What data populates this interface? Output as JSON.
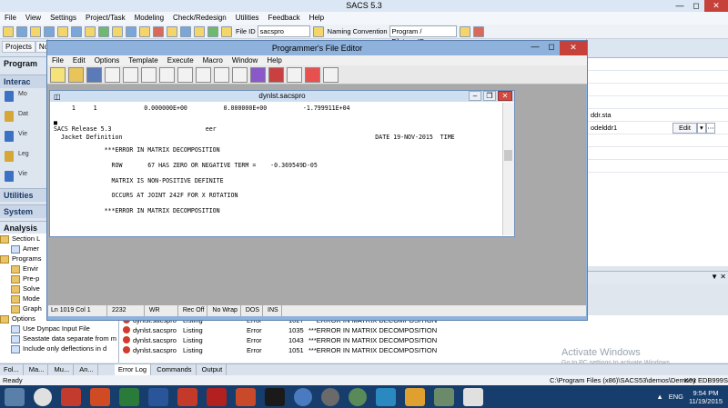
{
  "app": {
    "title": "SACS 5.3"
  },
  "menu": [
    "File",
    "View",
    "Settings",
    "Project/Task",
    "Modeling",
    "Check/Redesign",
    "Utilities",
    "Feedback",
    "Help"
  ],
  "toolbar": {
    "file_id_label": "File ID",
    "file_id_value": "sacspro",
    "naming_label": "Naming Convention",
    "naming_value": "Program / Filetype.ID"
  },
  "left": {
    "tabs": [
      "Projects",
      "No"
    ],
    "program_head": "Program",
    "interactive": "Interac",
    "items": [
      "Mo",
      "Dat",
      "Vie",
      "Leg",
      "Vie"
    ],
    "utilities": "Utilities",
    "system": "System",
    "analysis": "Analysis S"
  },
  "tree": [
    "Section L",
    "Amer",
    "Programs",
    "Envir",
    "Pre-p",
    "Solve",
    "Mode",
    "Graph",
    "Options",
    "Use Dynpac Input File",
    "Seastate data separate from m",
    "Include only deflections in d"
  ],
  "right": {
    "file1": "ddr.sta",
    "file2": "odelddr1",
    "edit": "Edit"
  },
  "editor": {
    "title": "Programmer's File Editor",
    "menu": [
      "File",
      "Edit",
      "Options",
      "Template",
      "Execute",
      "Macro",
      "Window",
      "Help"
    ],
    "child_title": "dynlst.sacspro",
    "lines": [
      "     1     1             0.000000E+00          0.000000E+00          -1.799911E+04",
      "",
      "■",
      "SACS Release 5.3                          eer",
      "  Jacket Definition                                                                      DATE 19-NOV-2015  TIME",
      "",
      "              ***ERROR IN MATRIX DECOMPOSITION",
      "",
      "                ROW       67 HAS ZERO OR NEGATIVE TERM =    -0.369549D-05",
      "",
      "                MATRIX IS NON-POSITIVE DEFINITE",
      "",
      "                OCCURS AT JOINT 242F FOR X ROTATION",
      "",
      "              ***ERROR IN MATRIX DECOMPOSITION"
    ],
    "status": [
      "Ln 1019 Col 1",
      "2232",
      "WR",
      "Rec Off",
      "No Wrap",
      "DOS",
      "INS"
    ]
  },
  "errors": [
    {
      "file": "dynlst.sacspro",
      "type": "Listing",
      "sev": "Error",
      "line": "1027",
      "msg": "***ERROR IN MATRIX DECOMPOSITION"
    },
    {
      "file": "dynlst.sacspro",
      "type": "Listing",
      "sev": "Error",
      "line": "1035",
      "msg": "***ERROR IN MATRIX DECOMPOSITION"
    },
    {
      "file": "dynlst.sacspro",
      "type": "Listing",
      "sev": "Error",
      "line": "1043",
      "msg": "***ERROR IN MATRIX DECOMPOSITION"
    },
    {
      "file": "dynlst.sacspro",
      "type": "Listing",
      "sev": "Error",
      "line": "1051",
      "msg": "***ERROR IN MATRIX DECOMPOSITION"
    }
  ],
  "bottom_tabs": [
    "Fol...",
    "Ma...",
    "Mu...",
    "An...",
    "Error Log",
    "Commands",
    "Output"
  ],
  "status": {
    "left": "Ready",
    "path": "C:\\Program Files (x86)\\SACS53\\demos\\Demo01",
    "key": "Key EDB999S"
  },
  "watermark": {
    "line1": "Activate Windows",
    "line2": "Go to PC settings to activate Windows."
  },
  "clock": {
    "time": "9:54 PM",
    "date": "11/19/2015",
    "lang": "ENG"
  }
}
